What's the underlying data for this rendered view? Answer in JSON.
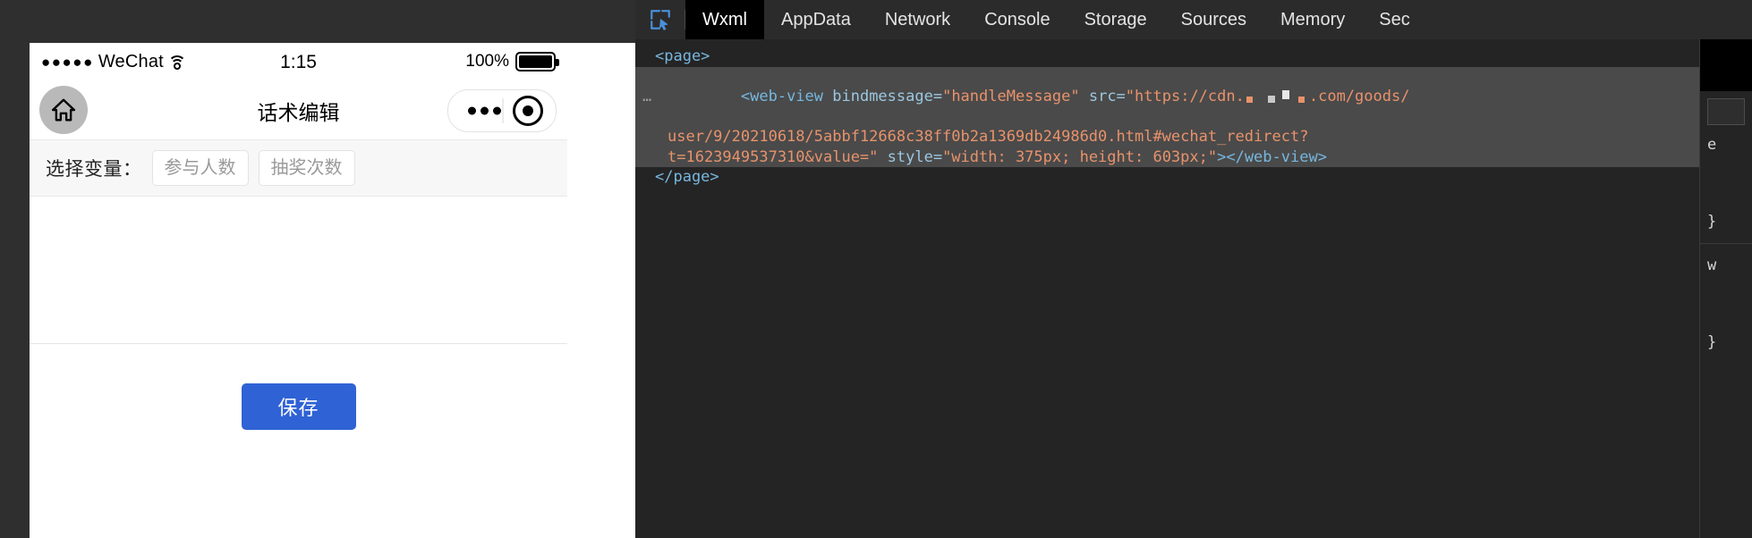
{
  "simulator": {
    "status_bar": {
      "signal_dots": "●●●●●",
      "carrier": "WeChat",
      "wifi_icon": "wifi-icon",
      "time": "1:15",
      "battery_percent": "100%",
      "battery_icon": "battery-full-icon"
    },
    "nav_bar": {
      "home_icon": "home-icon",
      "title": "话术编辑",
      "capsule": {
        "more_icon": "more-dots-icon",
        "target_icon": "target-circle-icon"
      }
    },
    "variable_row": {
      "label": "选择变量：",
      "chips": [
        "参与人数",
        "抽奖次数"
      ]
    },
    "save_button": "保存"
  },
  "devtools": {
    "inspect_icon": "inspect-element-icon",
    "tabs": [
      {
        "label": "Wxml",
        "active": true
      },
      {
        "label": "AppData",
        "active": false
      },
      {
        "label": "Network",
        "active": false
      },
      {
        "label": "Console",
        "active": false
      },
      {
        "label": "Storage",
        "active": false
      },
      {
        "label": "Sources",
        "active": false
      },
      {
        "label": "Memory",
        "active": false
      },
      {
        "label": "Sec",
        "active": false
      }
    ],
    "code": {
      "line1": "<page>",
      "ellipsis": "…",
      "line2_tag_open": "<web-view ",
      "line2_attr1": "bindmessage=",
      "line2_val1": "\"handleMessage\"",
      "line2_attr2": " src=",
      "line2_val2_a": "\"https://cdn.",
      "line2_redacted": "redacted-domain",
      "line2_val2_b": ".com/goods/",
      "line3": "user/9/20210618/5abbf12668c38ff0b2a1369db24986d0.html#wechat_redirect?",
      "line4_val": "t=1623949537310&value=\"",
      "line4_attr": " style=",
      "line4_style": "\"width: 375px; height: 603px;\"",
      "line4_close": "></web-view>",
      "line5": "</page>"
    },
    "side_panel": {
      "row1": "e",
      "row2": "}",
      "row3": "w",
      "row4": "}"
    }
  },
  "colors": {
    "accent_blue": "#2f62d4",
    "devtools_bg": "#242424",
    "tab_active_bg": "#000000",
    "code_string": "#e8926b",
    "code_tag": "#77b7df",
    "selection_bg": "#4a4a4a"
  }
}
